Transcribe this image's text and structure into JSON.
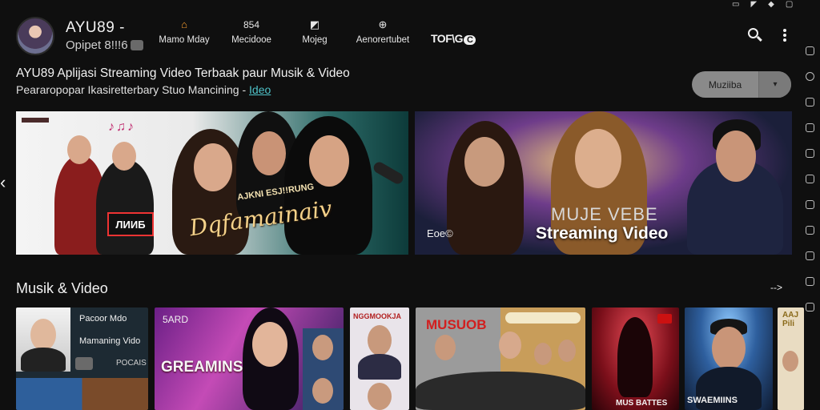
{
  "app": {
    "name": "AYU89 -",
    "subtitle": "Opipet 8!!!6"
  },
  "nav": [
    {
      "label": "Mamo Mday",
      "icon": "home-icon"
    },
    {
      "label": "Mecidooe",
      "icon": "music-note-icon"
    },
    {
      "label": "Mojeg",
      "icon": "video-icon"
    },
    {
      "label": "Aenorertubet",
      "icon": "puzzle-icon"
    }
  ],
  "nav_badge": {
    "text": "TOF\\G",
    "pill": "C"
  },
  "nav_badge_number": "854",
  "headline": "AYU89 Aplijasi Streaming Video Terbaak paur Musik & Video",
  "subline": "Peararopopar Ikasiretterbary Stuo Mancining - ",
  "subline_highlight": "Ideo",
  "split_button": {
    "label": "Muziiba",
    "caret": "▾"
  },
  "banners": [
    {
      "title": "Dqfamainaiv",
      "subtitle": "AJKNI ESJ!!RUNG",
      "badge": "ЛИИБ"
    },
    {
      "title_line1": "MUJE VEBE",
      "title_line2": "Streaming Video",
      "badge": "Eoe©"
    }
  ],
  "section": {
    "title": "Musik & Video",
    "more": "-->"
  },
  "cards": [
    {
      "line1": "Pacoor Mdo",
      "line2": "Mamaning Vido",
      "line3": "POCAIS"
    },
    {
      "line1": "5ARD",
      "line2": "GREAMINS"
    },
    {
      "line1": "NGGMOOKJA"
    },
    {
      "line1": "MUSUOB"
    },
    {
      "line1": "MUS BATTES"
    },
    {
      "line1": "SWAEMIINS"
    },
    {
      "line1": "AAJ Pili"
    }
  ],
  "colors": {
    "background": "#0f0f0f",
    "accent_link": "#4fc3c9",
    "split_button": "#8a8a8a"
  }
}
